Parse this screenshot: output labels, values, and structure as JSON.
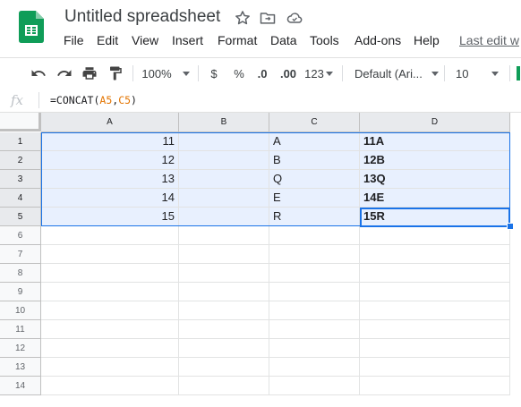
{
  "header": {
    "title": "Untitled spreadsheet",
    "icons": [
      "star-icon",
      "move-to-folder-icon",
      "cloud-saved-icon"
    ]
  },
  "menu": {
    "items": [
      "File",
      "Edit",
      "View",
      "Insert",
      "Format",
      "Data",
      "Tools",
      "Add-ons",
      "Help"
    ],
    "last_edit": "Last edit w"
  },
  "toolbar": {
    "zoom": "100%",
    "currency": "$",
    "percent": "%",
    "decrease_decimal": ".0",
    "increase_decimal": ".00",
    "more_formats": "123",
    "font": "Default (Ari...",
    "font_size": "10"
  },
  "formula_bar": {
    "fx": "fx",
    "prefix": "=CONCAT(",
    "ref1": "A5",
    "comma": ",",
    "ref2": "C5",
    "suffix": ")"
  },
  "grid": {
    "columns": [
      "A",
      "B",
      "C",
      "D"
    ],
    "rows": [
      "1",
      "2",
      "3",
      "4",
      "5",
      "6",
      "7",
      "8",
      "9",
      "10",
      "11",
      "12",
      "13",
      "14"
    ],
    "data": [
      {
        "a": "11",
        "c": "A",
        "d": "11A"
      },
      {
        "a": "12",
        "c": "B",
        "d": "12B"
      },
      {
        "a": "13",
        "c": "Q",
        "d": "13Q"
      },
      {
        "a": "14",
        "c": "E",
        "d": "14E"
      },
      {
        "a": "15",
        "c": "R",
        "d": "15R"
      }
    ],
    "active_cell": "D5"
  },
  "colors": {
    "accent": "#1a73e8",
    "selection_fill": "#e8f0fe",
    "header_bg": "#f8f9fa",
    "logo_green": "#0f9d58"
  }
}
